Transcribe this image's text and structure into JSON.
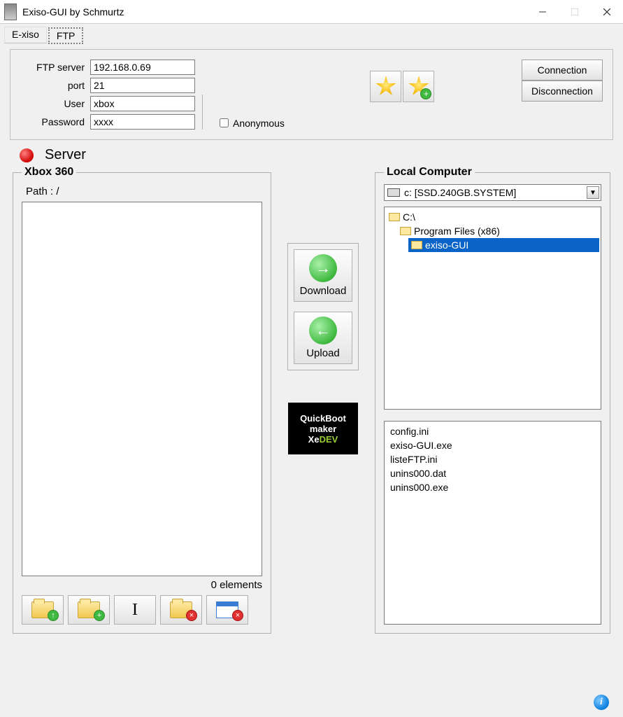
{
  "window": {
    "title": "Exiso-GUI by Schmurtz"
  },
  "tabs": {
    "exiso": "E-xiso",
    "ftp": "FTP",
    "active": "FTP"
  },
  "ftp": {
    "labels": {
      "server": "FTP server",
      "port": "port",
      "user": "User",
      "password": "Password",
      "anonymous": "Anonymous"
    },
    "values": {
      "server": "192.168.0.69",
      "port": "21",
      "user": "xbox",
      "password": "xxxx"
    }
  },
  "buttons": {
    "connection": "Connection",
    "disconnection": "Disconnection",
    "download": "Download",
    "upload": "Upload"
  },
  "server": {
    "label": "Server"
  },
  "quickboot": {
    "line1": "QuickBoot",
    "line2": "maker",
    "brand_xe": "Xe",
    "brand_dev": "DEV"
  },
  "xbox": {
    "title": "Xbox 360",
    "path_label": "Path :",
    "path_value": "/",
    "elements": "0 elements"
  },
  "local": {
    "title": "Local Computer",
    "drive": "c: [SSD.240GB.SYSTEM]",
    "tree": [
      {
        "level": 1,
        "label": "C:\\",
        "open": true,
        "selected": false
      },
      {
        "level": 2,
        "label": "Program Files (x86)",
        "open": true,
        "selected": false
      },
      {
        "level": 3,
        "label": "exiso-GUI",
        "open": true,
        "selected": true
      }
    ],
    "files": [
      "config.ini",
      "exiso-GUI.exe",
      "listeFTP.ini",
      "unins000.dat",
      "unins000.exe"
    ]
  }
}
